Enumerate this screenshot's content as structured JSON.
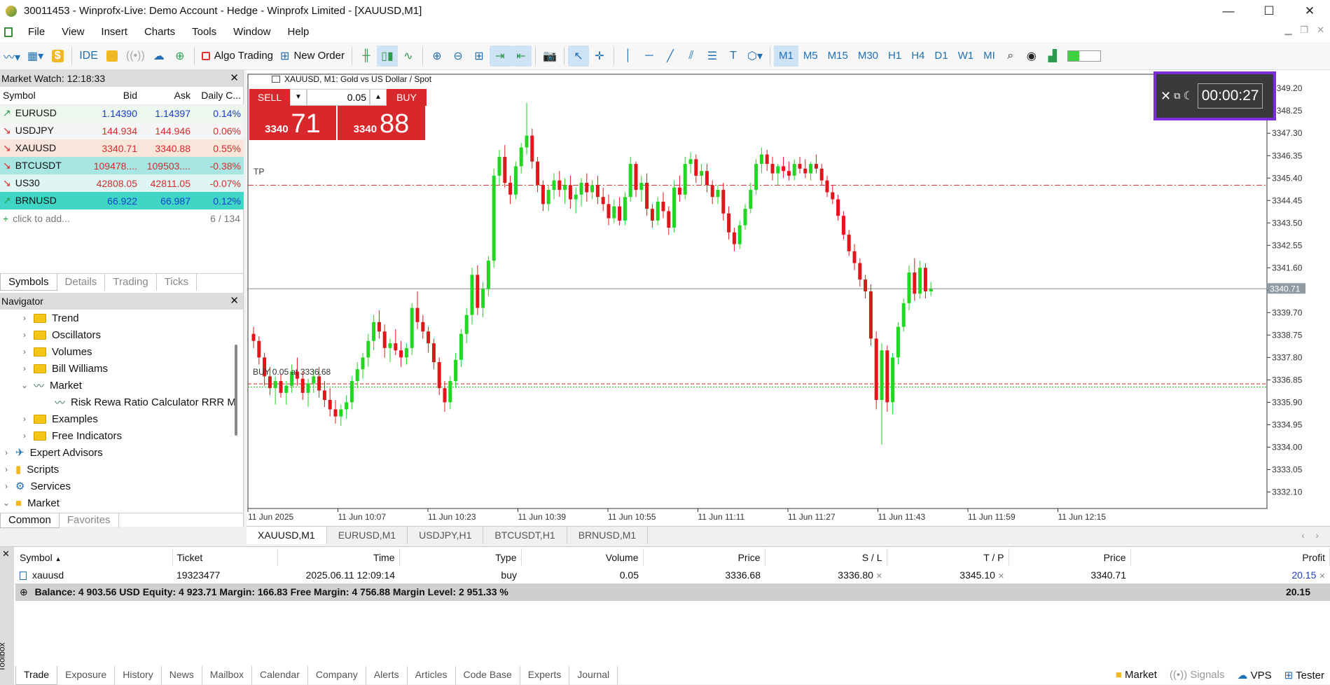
{
  "window": {
    "title": "30011453 - Winprofx-Live: Demo Account - Hedge - Winprofx Limited - [XAUUSD,M1]",
    "minimize": "—",
    "maximize": "☐",
    "close": "✕"
  },
  "menu": [
    "File",
    "View",
    "Insert",
    "Charts",
    "Tools",
    "Window",
    "Help"
  ],
  "toolbar": {
    "algo_trading": "Algo Trading",
    "new_order": "New Order",
    "ide": "IDE",
    "timeframes": [
      "M1",
      "M5",
      "M15",
      "M30",
      "H1",
      "H4",
      "D1",
      "W1",
      "MI"
    ],
    "active_tf": "M1"
  },
  "market_watch": {
    "title": "Market Watch: 12:18:33",
    "headers": [
      "Symbol",
      "Bid",
      "Ask",
      "Daily C..."
    ],
    "rows": [
      {
        "symbol": "EURUSD",
        "bid": "1.14390",
        "ask": "1.14397",
        "change": "0.14%",
        "dir": "up",
        "bg": "#eef7ee",
        "color": "#1a3ccf"
      },
      {
        "symbol": "USDJPY",
        "bid": "144.934",
        "ask": "144.946",
        "change": "0.06%",
        "dir": "down",
        "bg": "#f5f5f5",
        "color": "#d62b2b"
      },
      {
        "symbol": "XAUUSD",
        "bid": "3340.71",
        "ask": "3340.88",
        "change": "0.55%",
        "dir": "down",
        "bg": "#f7e6d9",
        "color": "#d62b2b"
      },
      {
        "symbol": "BTCUSDT",
        "bid": "109478....",
        "ask": "109503....",
        "change": "-0.38%",
        "dir": "down",
        "bg": "#a7e6e2",
        "color": "#d62b2b"
      },
      {
        "symbol": "US30",
        "bid": "42808.05",
        "ask": "42811.05",
        "change": "-0.07%",
        "dir": "down",
        "bg": "#dff5f3",
        "color": "#d62b2b"
      },
      {
        "symbol": "BRNUSD",
        "bid": "66.922",
        "ask": "66.987",
        "change": "0.12%",
        "dir": "up",
        "bg": "#3fd6c6",
        "color": "#1a3ccf"
      }
    ],
    "add_label": "click to add...",
    "count": "6 / 134",
    "tabs": [
      "Symbols",
      "Details",
      "Trading",
      "Ticks"
    ]
  },
  "navigator": {
    "title": "Navigator",
    "items": [
      {
        "label": "Trend",
        "indent": 2,
        "type": "folder",
        "chev": "›"
      },
      {
        "label": "Oscillators",
        "indent": 2,
        "type": "folder",
        "chev": "›"
      },
      {
        "label": "Volumes",
        "indent": 2,
        "type": "folder",
        "chev": "›"
      },
      {
        "label": "Bill Williams",
        "indent": 2,
        "type": "folder",
        "chev": "›"
      },
      {
        "label": "Market",
        "indent": 2,
        "type": "indicator",
        "chev": "⌄"
      },
      {
        "label": "Risk Rewa Ratio Calculator RRR M",
        "indent": 3,
        "type": "indicator",
        "chev": ""
      },
      {
        "label": "Examples",
        "indent": 2,
        "type": "folder",
        "chev": "›"
      },
      {
        "label": "Free Indicators",
        "indent": 2,
        "type": "folder",
        "chev": "›"
      },
      {
        "label": "Expert Advisors",
        "indent": 1,
        "type": "ea",
        "chev": "›"
      },
      {
        "label": "Scripts",
        "indent": 1,
        "type": "script",
        "chev": "›"
      },
      {
        "label": "Services",
        "indent": 1,
        "type": "service",
        "chev": "›"
      },
      {
        "label": "Market",
        "indent": 1,
        "type": "market",
        "chev": "⌄"
      }
    ],
    "tabs": [
      "Common",
      "Favorites"
    ]
  },
  "chart": {
    "header": "XAUUSD, M1:  Gold vs US Dollar / Spot",
    "sell_label": "SELL",
    "buy_label": "BUY",
    "lot": "0.05",
    "sell_price_small": "3340",
    "sell_price_big": "71",
    "buy_price_small": "3340",
    "buy_price_big": "88",
    "tp_label": "TP",
    "buy_line_label": "BUY 0.05 at 3336.68",
    "timer": "00:00:27",
    "tabs": [
      "XAUUSD,M1",
      "EURUSD,M1",
      "USDJPY,H1",
      "BTCUSDT,H1",
      "BRNUSD,M1"
    ]
  },
  "chart_data": {
    "type": "candlestick",
    "ylim": [
      3331.4,
      3349.8
    ],
    "yticks": [
      3349.2,
      3348.25,
      3347.3,
      3346.35,
      3345.4,
      3344.45,
      3343.5,
      3342.55,
      3341.6,
      3340.65,
      3339.7,
      3338.75,
      3337.8,
      3336.85,
      3335.9,
      3334.95,
      3334.0,
      3333.05,
      3332.1
    ],
    "xtick_labels": [
      "11 Jun 2025",
      "11 Jun 10:07",
      "11 Jun 10:23",
      "11 Jun 10:39",
      "11 Jun 10:55",
      "11 Jun 11:11",
      "11 Jun 11:27",
      "11 Jun 11:43",
      "11 Jun 11:59",
      "11 Jun 12:15"
    ],
    "current_price": "3340.71",
    "tp_price": 3345.1,
    "buy_price": 3336.68,
    "bid_price": 3336.55,
    "candles": [
      [
        3338.8,
        3339.1,
        3338.2,
        3338.5
      ],
      [
        3338.5,
        3338.7,
        3337.5,
        3337.8
      ],
      [
        3337.8,
        3338.0,
        3336.6,
        3337.0
      ],
      [
        3337.0,
        3337.4,
        3336.2,
        3336.5
      ],
      [
        3336.5,
        3337.0,
        3335.8,
        3336.8
      ],
      [
        3336.8,
        3337.1,
        3336.1,
        3336.3
      ],
      [
        3336.3,
        3336.8,
        3335.8,
        3336.6
      ],
      [
        3336.6,
        3337.5,
        3336.3,
        3337.2
      ],
      [
        3337.2,
        3337.8,
        3336.6,
        3336.9
      ],
      [
        3336.9,
        3337.2,
        3336.0,
        3336.3
      ],
      [
        3336.3,
        3336.9,
        3335.7,
        3336.7
      ],
      [
        3336.7,
        3337.3,
        3336.3,
        3337.0
      ],
      [
        3337.0,
        3337.4,
        3336.1,
        3336.4
      ],
      [
        3336.4,
        3336.8,
        3335.7,
        3336.0
      ],
      [
        3336.0,
        3336.5,
        3335.3,
        3335.6
      ],
      [
        3335.6,
        3336.0,
        3335.0,
        3335.3
      ],
      [
        3335.3,
        3335.8,
        3334.9,
        3335.6
      ],
      [
        3335.6,
        3336.2,
        3335.2,
        3335.9
      ],
      [
        3335.9,
        3337.0,
        3335.6,
        3336.8
      ],
      [
        3336.8,
        3337.6,
        3336.5,
        3337.3
      ],
      [
        3337.3,
        3338.0,
        3336.9,
        3337.8
      ],
      [
        3337.8,
        3338.8,
        3337.4,
        3338.5
      ],
      [
        3338.5,
        3339.6,
        3338.1,
        3339.3
      ],
      [
        3339.3,
        3339.8,
        3338.6,
        3338.9
      ],
      [
        3338.9,
        3339.2,
        3337.8,
        3338.2
      ],
      [
        3338.2,
        3338.6,
        3337.6,
        3338.4
      ],
      [
        3338.4,
        3339.0,
        3337.9,
        3338.1
      ],
      [
        3338.1,
        3338.5,
        3337.4,
        3337.8
      ],
      [
        3337.8,
        3338.4,
        3337.5,
        3338.2
      ],
      [
        3338.2,
        3340.1,
        3337.9,
        3339.9
      ],
      [
        3339.9,
        3340.6,
        3339.0,
        3339.3
      ],
      [
        3339.3,
        3339.6,
        3338.6,
        3338.9
      ],
      [
        3338.9,
        3339.1,
        3338.0,
        3338.4
      ],
      [
        3338.4,
        3338.6,
        3337.3,
        3337.6
      ],
      [
        3337.6,
        3337.8,
        3336.2,
        3336.5
      ],
      [
        3336.5,
        3336.8,
        3335.5,
        3335.9
      ],
      [
        3335.9,
        3337.0,
        3335.6,
        3336.8
      ],
      [
        3336.8,
        3338.0,
        3336.5,
        3337.7
      ],
      [
        3337.7,
        3339.0,
        3337.4,
        3338.8
      ],
      [
        3338.8,
        3339.9,
        3338.4,
        3339.6
      ],
      [
        3339.6,
        3341.6,
        3339.2,
        3341.3
      ],
      [
        3341.3,
        3341.7,
        3339.6,
        3339.9
      ],
      [
        3339.9,
        3341.0,
        3339.5,
        3340.7
      ],
      [
        3340.7,
        3342.1,
        3340.4,
        3341.9
      ],
      [
        3341.9,
        3345.8,
        3341.6,
        3345.5
      ],
      [
        3345.5,
        3346.6,
        3345.1,
        3346.3
      ],
      [
        3346.3,
        3346.8,
        3345.0,
        3345.2
      ],
      [
        3345.2,
        3345.5,
        3344.3,
        3344.7
      ],
      [
        3344.7,
        3346.1,
        3344.5,
        3345.9
      ],
      [
        3345.9,
        3346.9,
        3345.6,
        3346.7
      ],
      [
        3346.7,
        3348.6,
        3346.4,
        3347.2
      ],
      [
        3347.2,
        3347.5,
        3345.8,
        3346.1
      ],
      [
        3346.1,
        3346.3,
        3344.8,
        3345.1
      ],
      [
        3345.1,
        3345.3,
        3344.0,
        3344.3
      ],
      [
        3344.3,
        3345.1,
        3344.0,
        3344.9
      ],
      [
        3344.9,
        3345.6,
        3344.5,
        3345.3
      ],
      [
        3345.3,
        3345.7,
        3344.6,
        3344.9
      ],
      [
        3344.9,
        3345.4,
        3344.3,
        3345.1
      ],
      [
        3345.1,
        3345.5,
        3344.1,
        3344.5
      ],
      [
        3344.5,
        3345.0,
        3343.9,
        3344.7
      ],
      [
        3344.7,
        3345.4,
        3344.2,
        3345.2
      ],
      [
        3345.2,
        3345.6,
        3344.4,
        3344.8
      ],
      [
        3344.8,
        3345.3,
        3344.5,
        3345.1
      ],
      [
        3345.1,
        3345.5,
        3344.3,
        3344.6
      ],
      [
        3344.6,
        3345.0,
        3344.0,
        3344.3
      ],
      [
        3344.3,
        3344.7,
        3343.4,
        3343.7
      ],
      [
        3343.7,
        3344.5,
        3343.5,
        3344.2
      ],
      [
        3344.2,
        3344.6,
        3343.4,
        3343.6
      ],
      [
        3343.6,
        3344.8,
        3343.4,
        3344.6
      ],
      [
        3344.6,
        3346.3,
        3344.4,
        3346.0
      ],
      [
        3346.0,
        3346.1,
        3344.6,
        3344.9
      ],
      [
        3344.9,
        3345.5,
        3344.4,
        3345.2
      ],
      [
        3345.2,
        3345.6,
        3343.8,
        3344.1
      ],
      [
        3344.1,
        3344.3,
        3343.3,
        3343.6
      ],
      [
        3343.6,
        3344.6,
        3343.4,
        3344.4
      ],
      [
        3344.4,
        3344.8,
        3343.7,
        3344.0
      ],
      [
        3344.0,
        3344.2,
        3343.0,
        3343.3
      ],
      [
        3343.3,
        3345.3,
        3343.1,
        3345.0
      ],
      [
        3345.0,
        3345.5,
        3344.4,
        3344.7
      ],
      [
        3344.7,
        3346.3,
        3344.5,
        3346.0
      ],
      [
        3346.0,
        3346.5,
        3345.6,
        3346.2
      ],
      [
        3346.2,
        3346.4,
        3345.2,
        3345.5
      ],
      [
        3345.5,
        3346.0,
        3345.1,
        3345.7
      ],
      [
        3345.7,
        3346.0,
        3344.8,
        3345.1
      ],
      [
        3345.1,
        3345.3,
        3344.3,
        3344.6
      ],
      [
        3344.6,
        3345.1,
        3344.3,
        3344.9
      ],
      [
        3344.9,
        3345.2,
        3343.6,
        3343.9
      ],
      [
        3343.9,
        3344.2,
        3342.8,
        3343.1
      ],
      [
        3343.1,
        3343.3,
        3342.3,
        3342.6
      ],
      [
        3342.6,
        3343.6,
        3342.4,
        3343.4
      ],
      [
        3343.4,
        3344.3,
        3343.2,
        3344.1
      ],
      [
        3344.1,
        3345.2,
        3343.9,
        3344.9
      ],
      [
        3344.9,
        3346.2,
        3344.7,
        3346.0
      ],
      [
        3346.0,
        3346.7,
        3345.6,
        3346.4
      ],
      [
        3346.4,
        3346.6,
        3345.7,
        3346.0
      ],
      [
        3346.0,
        3346.3,
        3345.3,
        3345.6
      ],
      [
        3345.6,
        3346.0,
        3345.1,
        3345.9
      ],
      [
        3345.9,
        3346.3,
        3345.4,
        3345.7
      ],
      [
        3345.7,
        3346.1,
        3345.3,
        3345.5
      ],
      [
        3345.5,
        3346.2,
        3345.3,
        3346.0
      ],
      [
        3346.0,
        3346.3,
        3345.6,
        3345.8
      ],
      [
        3345.8,
        3346.2,
        3345.4,
        3345.6
      ],
      [
        3345.6,
        3346.1,
        3345.3,
        3346.0
      ],
      [
        3346.0,
        3346.4,
        3345.6,
        3345.8
      ],
      [
        3345.8,
        3346.0,
        3345.1,
        3345.3
      ],
      [
        3345.3,
        3345.5,
        3344.6,
        3344.8
      ],
      [
        3344.8,
        3345.1,
        3344.3,
        3344.5
      ],
      [
        3344.5,
        3344.7,
        3343.6,
        3343.8
      ],
      [
        3343.8,
        3344.0,
        3342.8,
        3343.0
      ],
      [
        3343.0,
        3343.2,
        3342.1,
        3342.3
      ],
      [
        3342.3,
        3342.6,
        3341.5,
        3341.8
      ],
      [
        3341.8,
        3342.0,
        3340.8,
        3341.1
      ],
      [
        3341.1,
        3341.3,
        3340.3,
        3340.6
      ],
      [
        3340.6,
        3340.9,
        3338.3,
        3338.6
      ],
      [
        3338.6,
        3338.9,
        3335.6,
        3336.0
      ],
      [
        3336.0,
        3338.4,
        3334.1,
        3338.1
      ],
      [
        3338.1,
        3338.3,
        3335.5,
        3335.9
      ],
      [
        3335.9,
        3338.0,
        3335.4,
        3337.8
      ],
      [
        3337.8,
        3339.3,
        3337.5,
        3339.1
      ],
      [
        3339.1,
        3340.3,
        3338.9,
        3340.1
      ],
      [
        3340.1,
        3341.7,
        3339.8,
        3341.4
      ],
      [
        3341.4,
        3342.0,
        3340.2,
        3340.5
      ],
      [
        3340.5,
        3341.9,
        3340.3,
        3341.6
      ],
      [
        3341.6,
        3341.8,
        3340.3,
        3340.6
      ],
      [
        3340.6,
        3341.0,
        3340.4,
        3340.7
      ]
    ]
  },
  "positions": {
    "headers": [
      "Symbol",
      "Ticket",
      "Time",
      "Type",
      "Volume",
      "Price",
      "S / L",
      "T / P",
      "Price",
      "Profit"
    ],
    "row": {
      "symbol": "xauusd",
      "ticket": "19323477",
      "time": "2025.06.11 12:09:14",
      "type": "buy",
      "volume": "0.05",
      "price": "3336.68",
      "sl": "3336.80",
      "tp": "3345.10",
      "current": "3340.71",
      "profit": "20.15"
    },
    "balance_line": "Balance: 4 903.56 USD  Equity: 4 923.71  Margin: 166.83  Free Margin: 4 756.88  Margin Level: 2 951.33 %",
    "balance_profit": "20.15"
  },
  "toolbox": {
    "side_label": "Toolbox",
    "tabs": [
      "Trade",
      "Exposure",
      "History",
      "News",
      "Mailbox",
      "Calendar",
      "Company",
      "Alerts",
      "Articles",
      "Code Base",
      "Experts",
      "Journal"
    ],
    "status": [
      "Market",
      "Signals",
      "VPS",
      "Tester"
    ]
  }
}
